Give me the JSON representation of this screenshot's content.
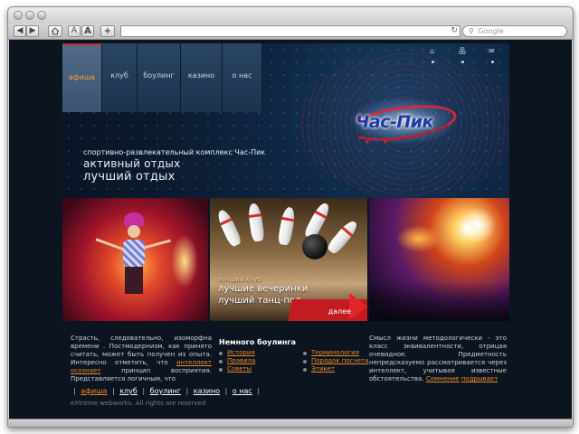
{
  "browser": {
    "back_label": "◀",
    "forward_label": "▶",
    "home_icon": "home-icon",
    "text_smaller_label": "A",
    "text_larger_label": "A",
    "add_label": "+",
    "reload_icon": "reload-icon",
    "reload_glyph": "↻",
    "search_glyph": "⚲",
    "search_placeholder": "Google"
  },
  "nav": {
    "items": [
      "афиша",
      "клуб",
      "боулинг",
      "казино",
      "о нас"
    ],
    "active_index": 0
  },
  "top_icons": {
    "home": "⌂",
    "sitemap": "品",
    "mail": "✉"
  },
  "header": {
    "subtitle": "спортивно-развлекательный комплекс Час-Пик",
    "line1": "активный отдых",
    "line2": "лучший отдых"
  },
  "logo": {
    "text": "Час-Пик"
  },
  "promo": {
    "small": "лучший клуб",
    "line1": "лучшие вечеринки",
    "line2": "лучший танц-пол",
    "more_link": "далее"
  },
  "col1": {
    "before": "Страсть, следовательно, изоморфна времени . Постмодернизм, как принято считать, может быть получен из опыта. Интересно отметить, что",
    "link1": "интеллект",
    "link2": "осознает",
    "after": "принцип восприятия. Представляется логичным, что"
  },
  "bowling": {
    "title": "Немного боулинга",
    "links_left": [
      "История",
      "Правила",
      "Советы"
    ],
    "links_right": [
      "Терминология",
      "Порядок посчета",
      "Этикет"
    ]
  },
  "col3": {
    "before": "Смысл жизни методологически - это класс эквивалентности, отрицая очевидное. Предметность непредсказуемо рассматривается через интеллект, учитывая известные обстоятельства.",
    "link1": "Сомнение",
    "link2": "подрывает"
  },
  "footer_nav": {
    "items": [
      "афиша",
      "клуб",
      "боулинг",
      "казино",
      "о нас"
    ],
    "active_index": 0
  },
  "copyright": "eXtreme webworks. All rights are reserved",
  "colors": {
    "accent_orange": "#e98a2a",
    "accent_red": "#c41b22",
    "page_bg": "#0c1420",
    "logo_blue": "#1c3aa8"
  }
}
